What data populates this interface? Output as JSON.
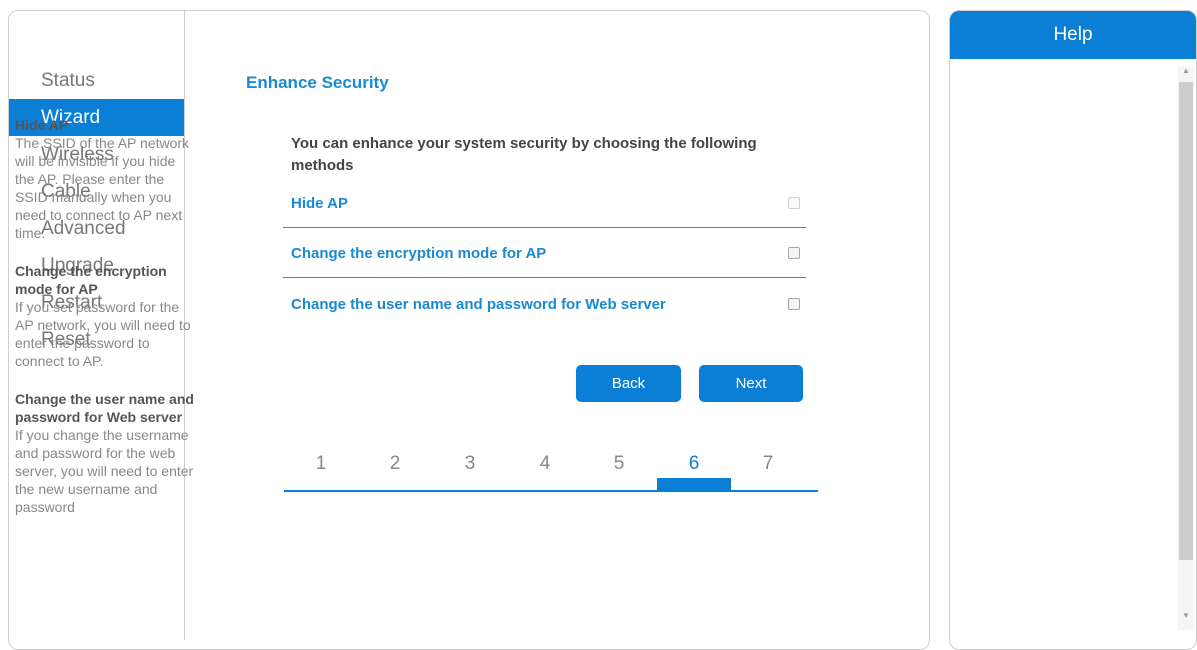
{
  "sidebar": {
    "items": [
      {
        "label": "Status"
      },
      {
        "label": "Wizard"
      },
      {
        "label": "Wireless"
      },
      {
        "label": "Cable"
      },
      {
        "label": "Advanced"
      },
      {
        "label": "Upgrade"
      },
      {
        "label": "Restart"
      },
      {
        "label": "Reset"
      }
    ],
    "active": "Wizard"
  },
  "main": {
    "title": "Enhance Security",
    "intro": "You can enhance your system security by choosing the following methods",
    "options": [
      {
        "label": "Hide AP",
        "checked": false
      },
      {
        "label": "Change the encryption mode for AP",
        "checked": false
      },
      {
        "label": "Change the user name and password for Web server",
        "checked": false
      }
    ],
    "buttons": {
      "back": "Back",
      "next": "Next"
    },
    "steps": [
      "1",
      "2",
      "3",
      "4",
      "5",
      "6",
      "7"
    ],
    "current_step": "6"
  },
  "help": {
    "title": "Help",
    "sections": [
      {
        "heading": "Hide AP",
        "text": "The SSID of the AP network will be invisible if you hide the AP. Please enter the SSID manually when you need to connect to AP next time."
      },
      {
        "heading": "Change the encryption mode for AP",
        "text": "If you set password for the AP network, you will need to enter the password to connect to AP."
      },
      {
        "heading": "Change the user name and password for Web server",
        "text": "If you change the username and password for the web server, you will need to enter the new username and password"
      }
    ]
  },
  "colors": {
    "accent": "#0b7fd6",
    "link": "#1a8ad0",
    "muted": "#888888"
  },
  "icons": {
    "scroll_up": "scroll-up-arrow-icon",
    "scroll_down": "scroll-down-arrow-icon"
  }
}
